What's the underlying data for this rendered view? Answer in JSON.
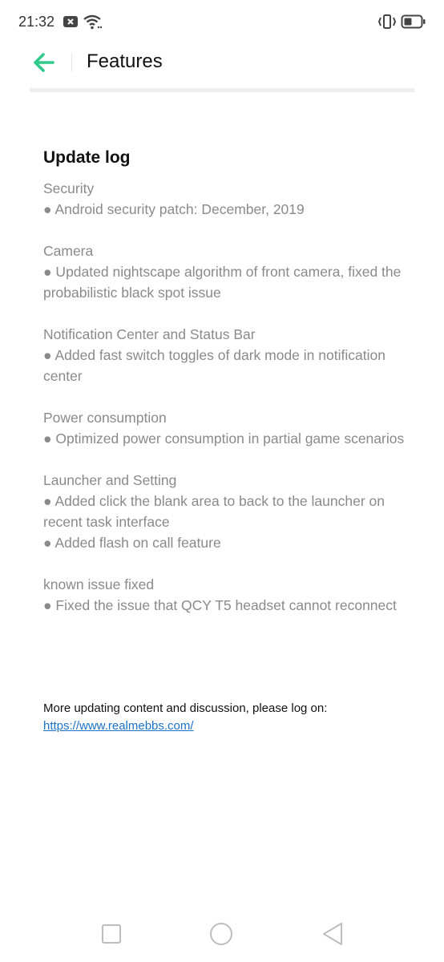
{
  "status_bar": {
    "time": "21:32",
    "icons": [
      "notification-x-icon",
      "wifi-icon",
      "vibrate-icon",
      "battery-icon"
    ]
  },
  "header": {
    "title": "Features",
    "back_icon": "arrow-left-icon",
    "accent_color": "#2fc98a"
  },
  "update_log": {
    "title": "Update log",
    "sections": [
      {
        "heading": "Security",
        "items": [
          "● Android security patch: December, 2019"
        ]
      },
      {
        "heading": "Camera",
        "items": [
          "● Updated nightscape algorithm of front camera, fixed the probabilistic black spot issue"
        ]
      },
      {
        "heading": "Notification Center and Status Bar",
        "items": [
          "● Added fast switch toggles of dark mode in notification center"
        ]
      },
      {
        "heading": "Power consumption",
        "items": [
          "● Optimized power consumption in partial game scenarios"
        ]
      },
      {
        "heading": "Launcher and Setting",
        "items": [
          "● Added click the blank area to back to the launcher on recent task interface",
          "● Added flash on call feature"
        ]
      },
      {
        "heading": "known issue fixed",
        "items": [
          "● Fixed the issue that QCY T5 headset cannot reconnect"
        ]
      }
    ]
  },
  "footer": {
    "note": "More updating content and discussion, please log on:",
    "link": "https://www.realmebbs.com/"
  },
  "nav_bar": {
    "icons": [
      "recent-apps-icon",
      "home-icon",
      "back-icon"
    ]
  }
}
